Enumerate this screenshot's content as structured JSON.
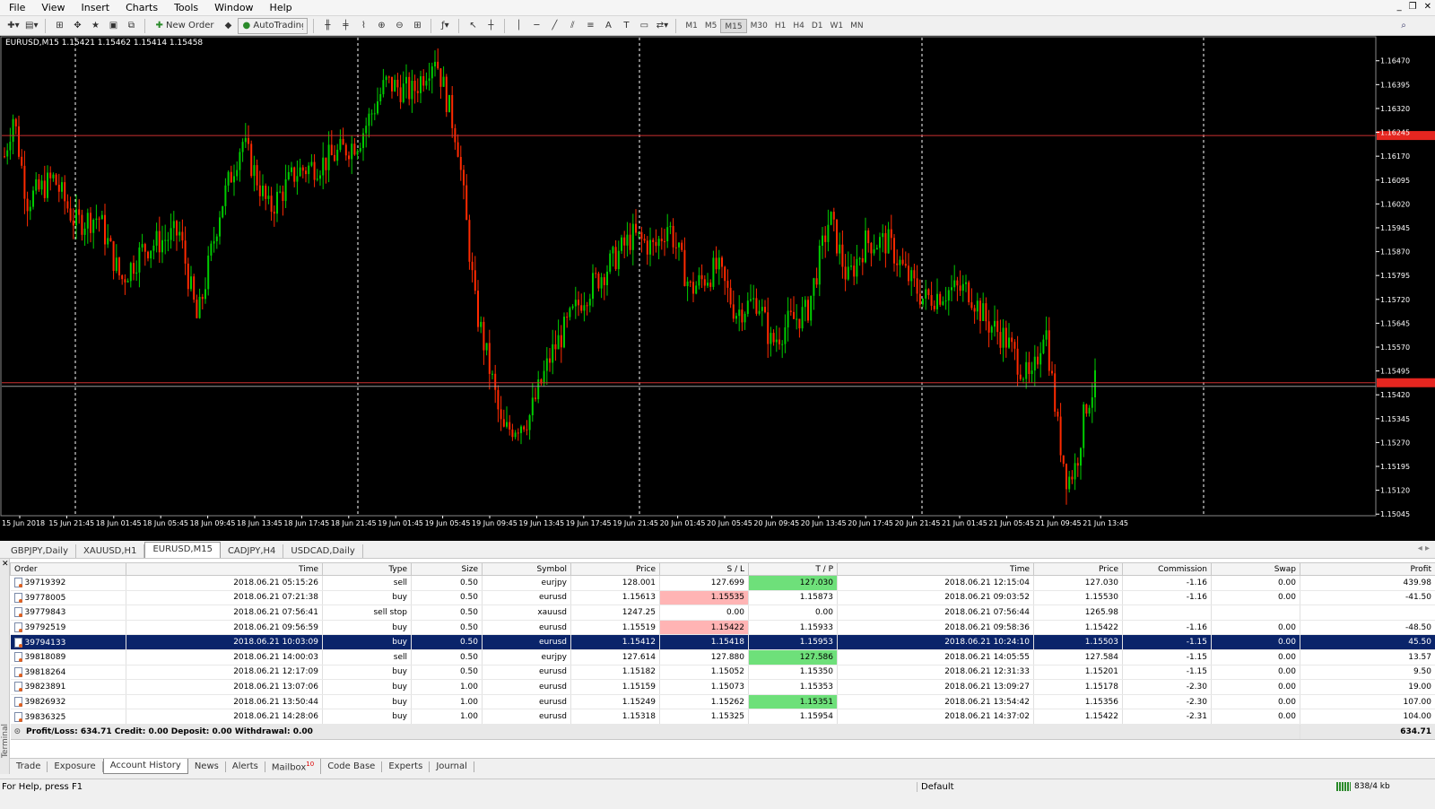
{
  "menu": [
    "File",
    "View",
    "Insert",
    "Charts",
    "Tools",
    "Window",
    "Help"
  ],
  "toolbar": {
    "new_order": "New Order",
    "autotrading": "AutoTrading",
    "timeframes": [
      "M1",
      "M5",
      "M15",
      "M30",
      "H1",
      "H4",
      "D1",
      "W1",
      "MN"
    ],
    "active_tf": "M15"
  },
  "chart": {
    "title": "EURUSD,M15  1.15421 1.15462 1.15414 1.15458",
    "price_labels": [
      "1.16470",
      "1.16395",
      "1.16320",
      "1.16245",
      "1.16170",
      "1.16095",
      "1.16020",
      "1.15945",
      "1.15870",
      "1.15795",
      "1.15720",
      "1.15645",
      "1.15570",
      "1.15495",
      "1.15420",
      "1.15345",
      "1.15270",
      "1.15195",
      "1.15120",
      "1.15045"
    ],
    "time_labels": [
      "15 Jun 2018",
      "15 Jun 21:45",
      "18 Jun 01:45",
      "18 Jun 05:45",
      "18 Jun 09:45",
      "18 Jun 13:45",
      "18 Jun 17:45",
      "18 Jun 21:45",
      "19 Jun 01:45",
      "19 Jun 05:45",
      "19 Jun 09:45",
      "19 Jun 13:45",
      "19 Jun 17:45",
      "19 Jun 21:45",
      "20 Jun 01:45",
      "20 Jun 05:45",
      "20 Jun 09:45",
      "20 Jun 13:45",
      "20 Jun 17:45",
      "20 Jun 21:45",
      "21 Jun 01:45",
      "21 Jun 05:45",
      "21 Jun 09:45",
      "21 Jun 13:45"
    ],
    "ylim": [
      1.1504,
      1.1652
    ],
    "hlines": [
      1.16235,
      1.15458
    ],
    "colors": {
      "up": "#00cc00",
      "down": "#ff2a00",
      "grid": "#ffffff",
      "hline": "#cc3030",
      "price_tag": "#e52620"
    }
  },
  "chart_tabs": [
    "GBPJPY,Daily",
    "XAUUSD,H1",
    "EURUSD,M15",
    "CADJPY,H4",
    "USDCAD,Daily"
  ],
  "active_chart_tab": "EURUSD,M15",
  "terminal": {
    "side_label": "Terminal",
    "columns": [
      "Order",
      "Time",
      "Type",
      "Size",
      "Symbol",
      "Price",
      "S / L",
      "T / P",
      "Time",
      "Price",
      "Commission",
      "Swap",
      "Profit"
    ],
    "rows": [
      {
        "order": "39719392",
        "open_time": "2018.06.21 05:15:26",
        "type": "sell",
        "size": "0.50",
        "symbol": "eurjpy",
        "price": "128.001",
        "sl": "127.699",
        "tp": "127.030",
        "close_time": "2018.06.21 12:15:04",
        "close_price": "127.030",
        "commission": "-1.16",
        "swap": "0.00",
        "profit": "439.98",
        "sl_hl": "",
        "tp_hl": "green"
      },
      {
        "order": "39778005",
        "open_time": "2018.06.21 07:21:38",
        "type": "buy",
        "size": "0.50",
        "symbol": "eurusd",
        "price": "1.15613",
        "sl": "1.15535",
        "tp": "1.15873",
        "close_time": "2018.06.21 09:03:52",
        "close_price": "1.15530",
        "commission": "-1.16",
        "swap": "0.00",
        "profit": "-41.50",
        "sl_hl": "red",
        "tp_hl": ""
      },
      {
        "order": "39779843",
        "open_time": "2018.06.21 07:56:41",
        "type": "sell stop",
        "size": "0.50",
        "symbol": "xauusd",
        "price": "1247.25",
        "sl": "0.00",
        "tp": "0.00",
        "close_time": "2018.06.21 07:56:44",
        "close_price": "1265.98",
        "commission": "",
        "swap": "",
        "profit": "",
        "sl_hl": "",
        "tp_hl": ""
      },
      {
        "order": "39792519",
        "open_time": "2018.06.21 09:56:59",
        "type": "buy",
        "size": "0.50",
        "symbol": "eurusd",
        "price": "1.15519",
        "sl": "1.15422",
        "tp": "1.15933",
        "close_time": "2018.06.21 09:58:36",
        "close_price": "1.15422",
        "commission": "-1.16",
        "swap": "0.00",
        "profit": "-48.50",
        "sl_hl": "red",
        "tp_hl": ""
      },
      {
        "order": "39794133",
        "open_time": "2018.06.21 10:03:09",
        "type": "buy",
        "size": "0.50",
        "symbol": "eurusd",
        "price": "1.15412",
        "sl": "1.15418",
        "tp": "1.15953",
        "close_time": "2018.06.21 10:24:10",
        "close_price": "1.15503",
        "commission": "-1.15",
        "swap": "0.00",
        "profit": "45.50",
        "sl_hl": "",
        "tp_hl": "",
        "selected": true
      },
      {
        "order": "39818089",
        "open_time": "2018.06.21 14:00:03",
        "type": "sell",
        "size": "0.50",
        "symbol": "eurjpy",
        "price": "127.614",
        "sl": "127.880",
        "tp": "127.586",
        "close_time": "2018.06.21 14:05:55",
        "close_price": "127.584",
        "commission": "-1.15",
        "swap": "0.00",
        "profit": "13.57",
        "sl_hl": "",
        "tp_hl": "green"
      },
      {
        "order": "39818264",
        "open_time": "2018.06.21 12:17:09",
        "type": "buy",
        "size": "0.50",
        "symbol": "eurusd",
        "price": "1.15182",
        "sl": "1.15052",
        "tp": "1.15350",
        "close_time": "2018.06.21 12:31:33",
        "close_price": "1.15201",
        "commission": "-1.15",
        "swap": "0.00",
        "profit": "9.50",
        "sl_hl": "",
        "tp_hl": ""
      },
      {
        "order": "39823891",
        "open_time": "2018.06.21 13:07:06",
        "type": "buy",
        "size": "1.00",
        "symbol": "eurusd",
        "price": "1.15159",
        "sl": "1.15073",
        "tp": "1.15353",
        "close_time": "2018.06.21 13:09:27",
        "close_price": "1.15178",
        "commission": "-2.30",
        "swap": "0.00",
        "profit": "19.00",
        "sl_hl": "",
        "tp_hl": ""
      },
      {
        "order": "39826932",
        "open_time": "2018.06.21 13:50:44",
        "type": "buy",
        "size": "1.00",
        "symbol": "eurusd",
        "price": "1.15249",
        "sl": "1.15262",
        "tp": "1.15351",
        "close_time": "2018.06.21 13:54:42",
        "close_price": "1.15356",
        "commission": "-2.30",
        "swap": "0.00",
        "profit": "107.00",
        "sl_hl": "",
        "tp_hl": "green"
      },
      {
        "order": "39836325",
        "open_time": "2018.06.21 14:28:06",
        "type": "buy",
        "size": "1.00",
        "symbol": "eurusd",
        "price": "1.15318",
        "sl": "1.15325",
        "tp": "1.15954",
        "close_time": "2018.06.21 14:37:02",
        "close_price": "1.15422",
        "commission": "-2.31",
        "swap": "0.00",
        "profit": "104.00",
        "sl_hl": "",
        "tp_hl": ""
      }
    ],
    "summary": {
      "text": "Profit/Loss: 634.71  Credit: 0.00  Deposit: 0.00  Withdrawal: 0.00",
      "total": "634.71"
    },
    "tabs": [
      "Trade",
      "Exposure",
      "Account History",
      "News",
      "Alerts",
      "Mailbox",
      "Code Base",
      "Experts",
      "Journal"
    ],
    "active_tab": "Account History",
    "mailbox_badge": "10"
  },
  "status": {
    "help": "For Help, press F1",
    "profile": "Default",
    "connection": "838/4 kb"
  }
}
